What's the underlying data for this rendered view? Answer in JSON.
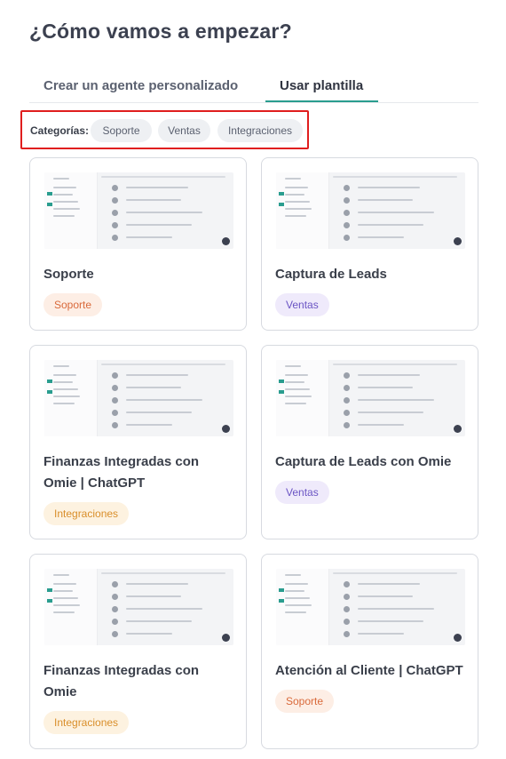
{
  "page_title": "¿Cómo vamos a empezar?",
  "tabs": [
    {
      "label": "Crear un agente personalizado",
      "active": false
    },
    {
      "label": "Usar plantilla",
      "active": true
    }
  ],
  "categories": {
    "label": "Categorías:",
    "chips": [
      "Soporte",
      "Ventas",
      "Integraciones"
    ]
  },
  "templates": [
    {
      "title": "Soporte",
      "tag": "Soporte"
    },
    {
      "title": "Captura de Leads",
      "tag": "Ventas"
    },
    {
      "title": "Finanzas Integradas con Omie | ChatGPT",
      "tag": "Integraciones"
    },
    {
      "title": "Captura de Leads con Omie",
      "tag": "Ventas"
    },
    {
      "title": "Finanzas Integradas con Omie",
      "tag": "Integraciones"
    },
    {
      "title": "Atención al Cliente | ChatGPT",
      "tag": "Soporte"
    }
  ],
  "colors": {
    "accent": "#2a9d8f",
    "highlight_box": "#e01e1e",
    "tag_soporte": "#d9693a",
    "tag_ventas": "#6b55c4",
    "tag_integraciones": "#d98e2a"
  }
}
